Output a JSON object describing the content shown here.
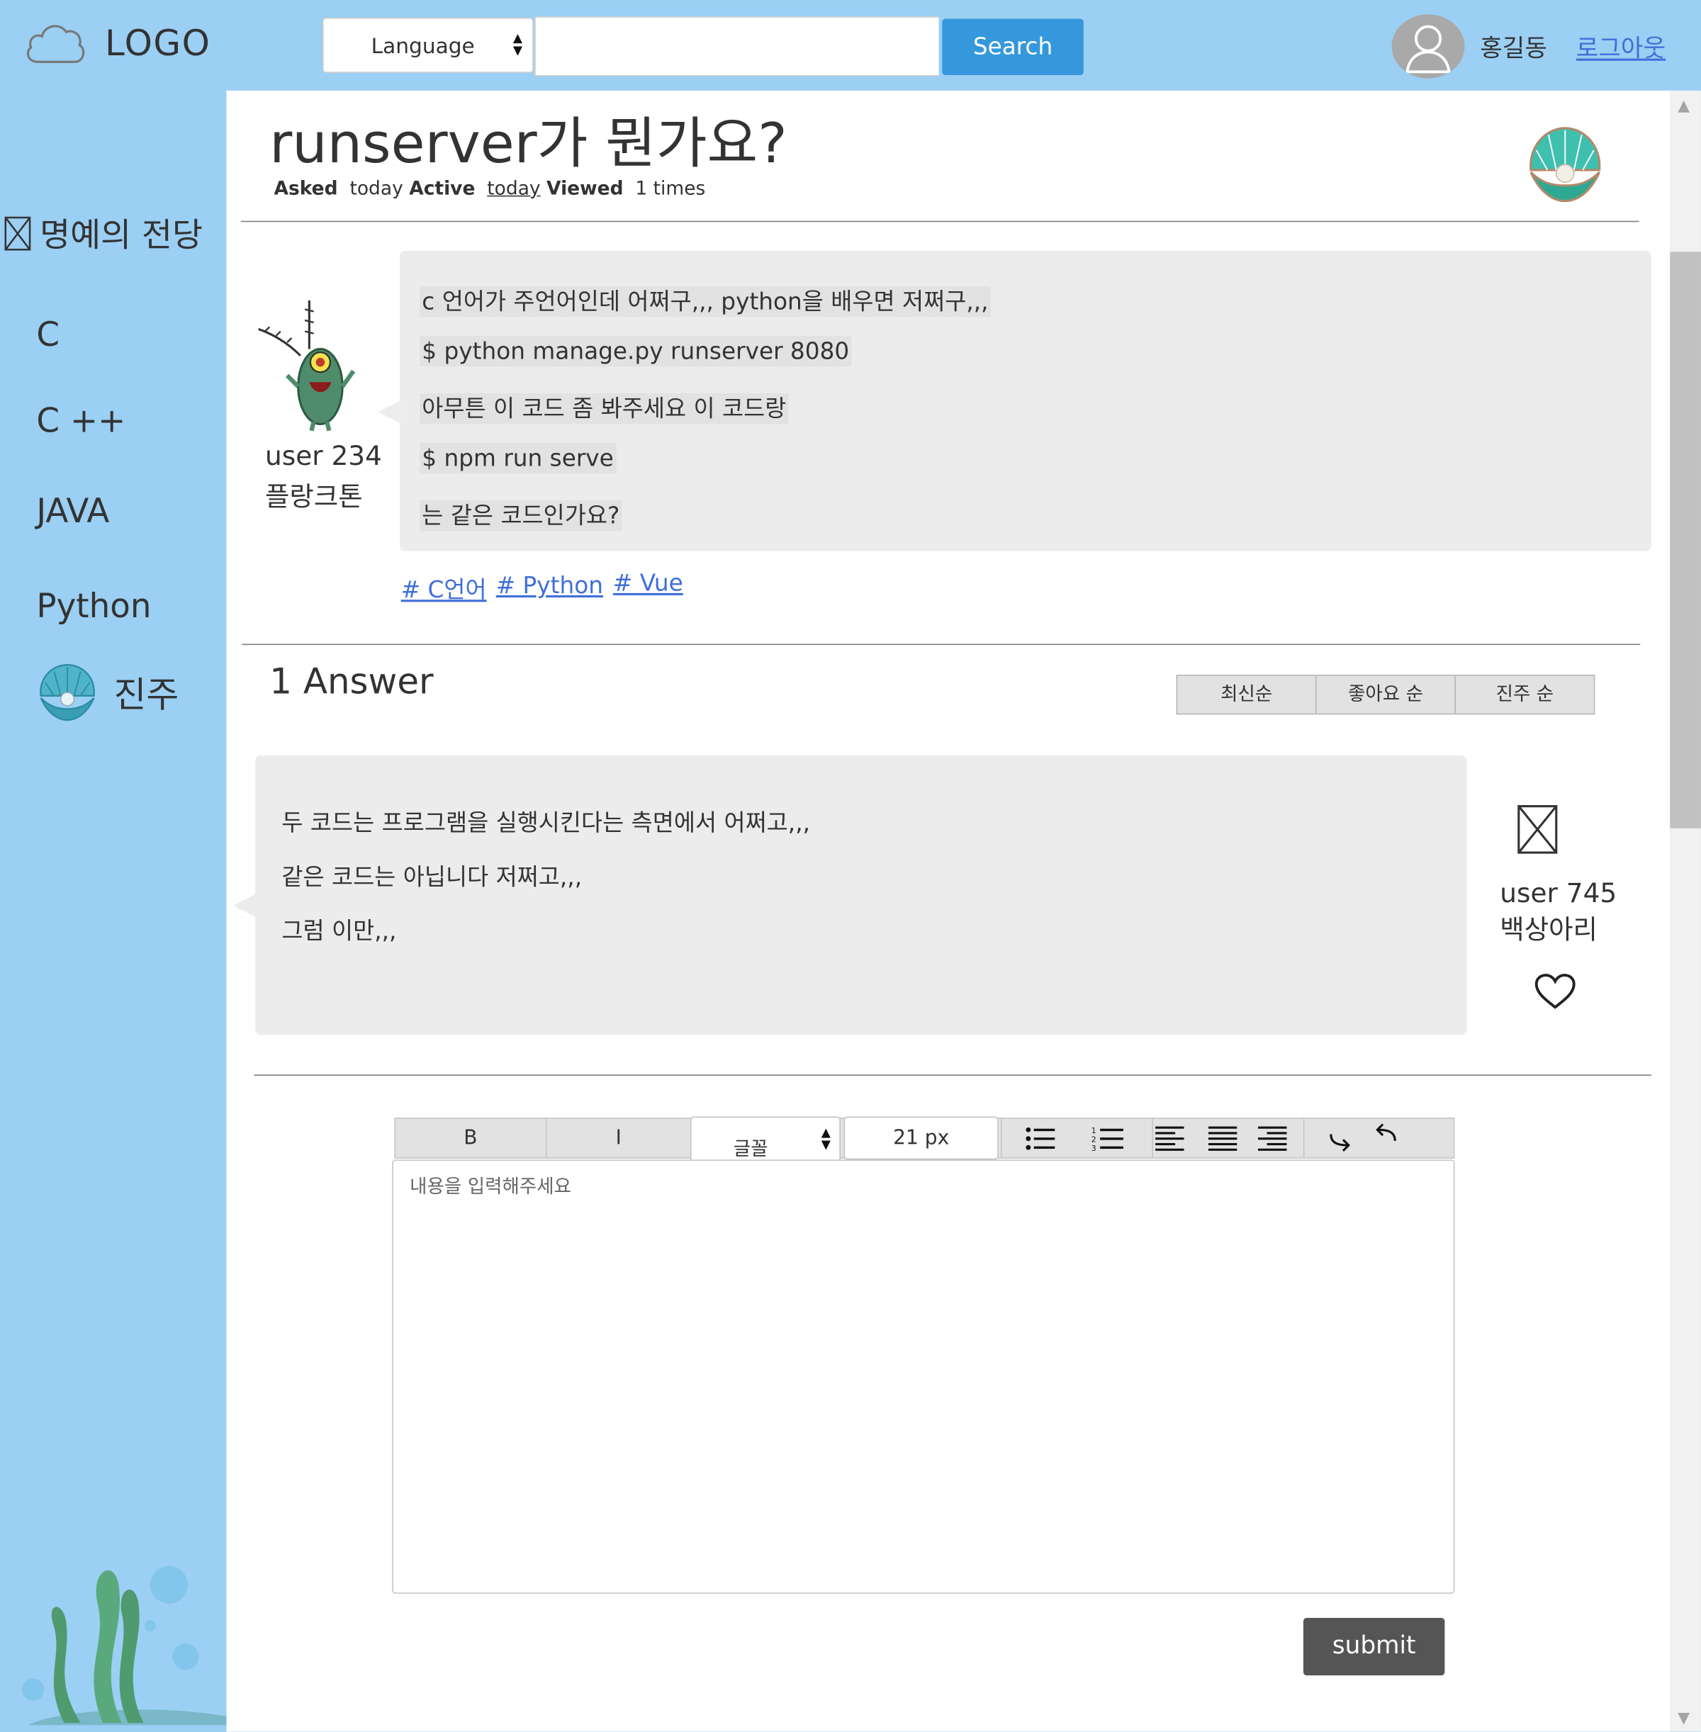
{
  "header": {
    "logo_text": "LOGO",
    "language_select": "Language",
    "search_placeholder": "",
    "search_button": "Search",
    "user_name": "홍길동",
    "logout_link": "로그아웃"
  },
  "sidebar": {
    "hall_of_fame": "명예의 전당",
    "items": [
      {
        "label": "C"
      },
      {
        "label": "C ++"
      },
      {
        "label": "JAVA"
      },
      {
        "label": "Python"
      },
      {
        "label": "진주"
      }
    ]
  },
  "question": {
    "title": "runserver가 뭔가요?",
    "meta": {
      "asked_label": "Asked",
      "asked_value": "today",
      "active_label": "Active",
      "active_value": "today",
      "viewed_label": "Viewed",
      "viewed_value": "1 times"
    },
    "author": {
      "id": "user 234",
      "nickname": "플랑크톤"
    },
    "body": [
      "c 언어가 주언어인데 어쩌구,,, python을 배우면 저쩌구,,,",
      "$ python manage.py runserver 8080",
      "아무튼 이 코드 좀 봐주세요 이 코드랑",
      "$ npm run serve",
      "는 같은 코드인가요?"
    ],
    "tags": [
      "# C언어",
      "# Python",
      "# Vue"
    ]
  },
  "answers": {
    "count_label": "1 Answer",
    "sort_options": [
      "최신순",
      "좋아요 순",
      "진주 순"
    ],
    "list": [
      {
        "body": [
          "두 코드는 프로그램을 실행시킨다는 측면에서 어쩌고,,,",
          "같은 코드는 아닙니다 저쩌고,,,",
          "그럼 이만,,,"
        ],
        "author": {
          "id": "user 745",
          "nickname": "백상아리"
        }
      }
    ]
  },
  "editor": {
    "bold": "B",
    "italic": "I",
    "font_select": "글꼴",
    "font_size": "21 px",
    "placeholder": "내용을 입력해주세요",
    "submit": "submit"
  },
  "colors": {
    "background": "#9bcff3",
    "accent": "#3598dc",
    "link": "#3f6fd9",
    "bubble": "#ececec",
    "submit": "#555555"
  },
  "icons": [
    "cloud-icon",
    "user-avatar-icon",
    "hall-of-fame-box-icon",
    "pearl-shell-icon",
    "plankton-avatar",
    "placeholder-box-icon",
    "heart-icon",
    "bullet-list-icon",
    "numbered-list-icon",
    "align-left-icon",
    "align-justify-icon",
    "align-right-icon",
    "redo-icon",
    "undo-icon",
    "seaweed-illustration"
  ]
}
